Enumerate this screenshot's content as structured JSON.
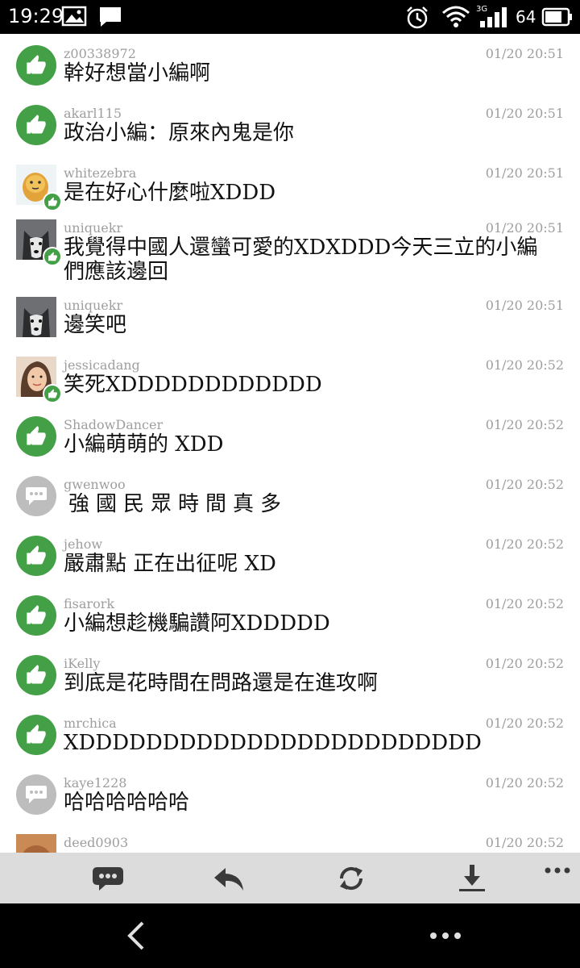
{
  "status_bar": {
    "time": "19:29",
    "network": "3G",
    "battery_level": "64",
    "icons": [
      "gallery-icon",
      "message-icon",
      "alarm-icon",
      "wifi-icon",
      "signal-icon",
      "battery-icon"
    ]
  },
  "comments": [
    {
      "user": "z00338972",
      "time": "01/20 20:51",
      "text": "幹好想當小編啊",
      "avatar": "thumb"
    },
    {
      "user": "akarl115",
      "time": "01/20 20:51",
      "text": "政治小編：原來內鬼是你",
      "avatar": "thumb"
    },
    {
      "user": "whitezebra",
      "time": "01/20 20:51",
      "text": "是在好心什麼啦XDDD",
      "avatar": "photo-egg"
    },
    {
      "user": "uniquekr",
      "time": "01/20 20:51",
      "text": "我覺得中國人還蠻可愛的XDXDDD今天三立的小編們應該邊回",
      "avatar": "photo-husky"
    },
    {
      "user": "uniquekr",
      "time": "01/20 20:51",
      "text": "邊笑吧",
      "avatar": "photo-husky-nobadge"
    },
    {
      "user": "jessicadang",
      "time": "01/20 20:52",
      "text": "笑死XDDDDDDDDDDDD",
      "avatar": "photo-girl"
    },
    {
      "user": "ShadowDancer",
      "time": "01/20 20:52",
      "text": "小編萌萌的 XDD",
      "avatar": "thumb"
    },
    {
      "user": "gwenwoo",
      "time": "01/20 20:52",
      "text": "強國民眾時間真多",
      "avatar": "bubble"
    },
    {
      "user": "jehow",
      "time": "01/20 20:52",
      "text": "嚴肅點 正在出征呢 XD",
      "avatar": "thumb"
    },
    {
      "user": "fisarork",
      "time": "01/20 20:52",
      "text": "小編想趁機騙讚阿XDDDDD",
      "avatar": "thumb"
    },
    {
      "user": "iKelly",
      "time": "01/20 20:52",
      "text": "到底是花時間在問路還是在進攻啊",
      "avatar": "thumb"
    },
    {
      "user": "mrchica",
      "time": "01/20 20:52",
      "text": "XDDDDDDDDDDDDDDDDDDDDDDDD",
      "avatar": "thumb"
    },
    {
      "user": "kaye1228",
      "time": "01/20 20:52",
      "text": "哈哈哈哈哈哈",
      "avatar": "bubble"
    },
    {
      "user": "deed0903",
      "time": "01/20 20:52",
      "text": "",
      "avatar": "photo-partial"
    }
  ],
  "toolbar": {
    "buttons": [
      "comment-icon",
      "reply-icon",
      "refresh-icon",
      "download-icon",
      "more-icon"
    ]
  },
  "nav_bar": {
    "buttons": [
      "back-icon",
      "menu-dots-icon"
    ]
  },
  "colors": {
    "accent_green": "#43a047",
    "bubble_gray": "#bdbdbd",
    "toolbar_bg": "#dcdcdc"
  }
}
